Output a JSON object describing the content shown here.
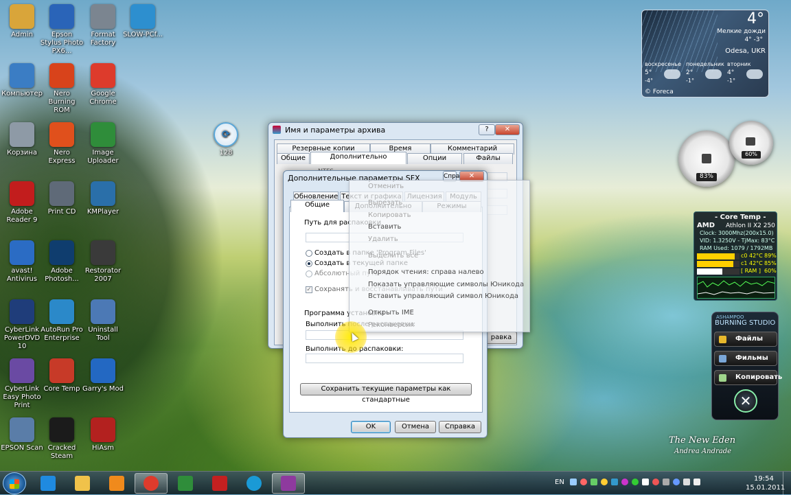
{
  "desktop_icons": [
    {
      "label": "Admin",
      "icon": "folder-user-icon",
      "color": "#d9a53a"
    },
    {
      "label": "Epson Stylus Photo PX6...",
      "icon": "printer-icon",
      "color": "#2a64b8"
    },
    {
      "label": "Format Factory",
      "icon": "camera-icon",
      "color": "#7b8590"
    },
    {
      "label": "SLOW-PCf...",
      "icon": "gauge-icon",
      "color": "#2d8fcf"
    },
    {
      "label": "Компьютер",
      "icon": "computer-icon",
      "color": "#3b7dc4"
    },
    {
      "label": "Nero Burning ROM",
      "icon": "nero-flame-icon",
      "color": "#d8431b"
    },
    {
      "label": "Google Chrome",
      "icon": "chrome-icon",
      "color": "#dd3b2c"
    },
    {
      "label": "Корзина",
      "icon": "recycle-bin-icon",
      "color": "#8e9aa6"
    },
    {
      "label": "Nero Express",
      "icon": "nero-flame-icon",
      "color": "#e0501c"
    },
    {
      "label": "Image Uploader",
      "icon": "md-logo-icon",
      "color": "#2f8d3a"
    },
    {
      "label": "Adobe Reader 9",
      "icon": "pdf-icon",
      "color": "#c21d1d"
    },
    {
      "label": "Print CD",
      "icon": "print-cd-icon",
      "color": "#5f6a78"
    },
    {
      "label": "KMPlayer",
      "icon": "kmplayer-icon",
      "color": "#2a6fa9"
    },
    {
      "label": "avast! Antivirus",
      "icon": "avast-icon",
      "color": "#2b6cc4"
    },
    {
      "label": "Adobe Photosh...",
      "icon": "photoshop-icon",
      "color": "#0f3d6e"
    },
    {
      "label": "Restorator 2007",
      "icon": "res-icon",
      "color": "#3a3a3a"
    },
    {
      "label": "CyberLink PowerDVD 10",
      "icon": "dvd-icon",
      "color": "#1f3d7a"
    },
    {
      "label": "AutoRun Pro Enterprise",
      "icon": "autorun-icon",
      "color": "#2b89c9"
    },
    {
      "label": "Uninstall Tool",
      "icon": "uninstall-icon",
      "color": "#4c79b5"
    },
    {
      "label": "CyberLink Easy Photo Print",
      "icon": "photo-print-icon",
      "color": "#6a4aa3"
    },
    {
      "label": "Core Temp",
      "icon": "thermometer-icon",
      "color": "#c73a28"
    },
    {
      "label": "Garry's Mod",
      "icon": "gmod-icon",
      "color": "#2368c2"
    },
    {
      "label": "EPSON Scan",
      "icon": "scanner-icon",
      "color": "#5a7da8"
    },
    {
      "label": "Cracked Steam",
      "icon": "steam-icon",
      "color": "#1b1b1b"
    },
    {
      "label": "HiAsm",
      "icon": "hiasm-icon",
      "color": "#b3211f"
    }
  ],
  "gauge_128": {
    "label": "128"
  },
  "weather": {
    "temp": "4°",
    "desc": "Мелкие дожди",
    "hilo": "4° -3°",
    "city": "Odesa, UKR",
    "days": [
      {
        "name": "воскресенье",
        "hi": "5°",
        "lo": "-4°"
      },
      {
        "name": "понедельник",
        "hi": "2°",
        "lo": "-1°"
      },
      {
        "name": "вторник",
        "hi": "4°",
        "lo": "-1°"
      }
    ],
    "source": "© Foreca"
  },
  "meters": {
    "cpu": "83%",
    "ram": "60%"
  },
  "core_temp": {
    "title": "- Core Temp -",
    "brand": "AMD",
    "cpu_model": "Athlon II X2 250",
    "clock": "Clock: 3000Mhz(200x15.0)",
    "vid": "VID: 1.3250V - TjMax: 83°C",
    "ram_used": "RAM Used: 1079 / 1792MB",
    "c0_label": "c0",
    "c0_temp": "42°C",
    "c0_load": "89%",
    "c1_label": "c1",
    "c1_temp": "42°C",
    "c1_load": "85%",
    "ram_label": "[ RAM ]",
    "ram_load": "60%",
    "c0_pct": 89,
    "c1_pct": 85,
    "ram_pct": 60
  },
  "burning_studio": {
    "brand": "ASHAMPOO",
    "title": "BURNING STUDIO",
    "buttons": [
      "Файлы",
      "Фильмы",
      "Копировать"
    ]
  },
  "watermark": {
    "line1": "The New Eden",
    "line2": "Andrea Andrade"
  },
  "archive_window": {
    "title": "Имя и параметры архива",
    "tabs_row1": [
      "Резервные копии",
      "Время",
      "Комментарий"
    ],
    "tabs_row2": [
      "Общие",
      "Дополнительно",
      "Опции",
      "Файлы"
    ],
    "help": "?",
    "close": "✕",
    "behind_btn": "равка",
    "behind_label": "NTFS"
  },
  "sfx_window": {
    "title": "Дополнительные параметры SFX",
    "tabs_row1": [
      "Обновление",
      "Текст и графика",
      "Лицензия",
      "Модуль"
    ],
    "tabs_row2": [
      "Общие",
      "Дополнительно",
      "Режимы"
    ],
    "path_label": "Путь для распаковки",
    "radio1": "Создать в папке 'Program Files'",
    "radio2": "Создать в текущей папке",
    "radio3": "Абсолютный путь",
    "checkbox": "Сохранять и восстанавливать пути",
    "setup_group": "Программа установки",
    "after_label": "Выполнить после распаковки:",
    "before_label": "Выполнить до распаковки:",
    "save_default": "Сохранить текущие параметры как стандартные",
    "ok": "OK",
    "cancel": "Отмена",
    "help": "Справка"
  },
  "context_menu": {
    "items": [
      "Отменить",
      "Вырезать",
      "Копировать",
      "Вставить",
      "Удалить",
      "Выделить все",
      "Порядок чтения: справа налево",
      "Показать управляющие символы Юникода",
      "Вставить управляющий символ Юникода",
      "Открыть IME",
      "Реконверсия"
    ]
  },
  "taskbar": {
    "lang": "EN",
    "time": "19:54",
    "date": "15.01.2011",
    "apps": [
      "ie-icon",
      "explorer-icon",
      "media-player-icon",
      "chrome-icon",
      "image-uploader-icon",
      "hiasm-icon",
      "skype-icon",
      "winrar-icon"
    ]
  }
}
